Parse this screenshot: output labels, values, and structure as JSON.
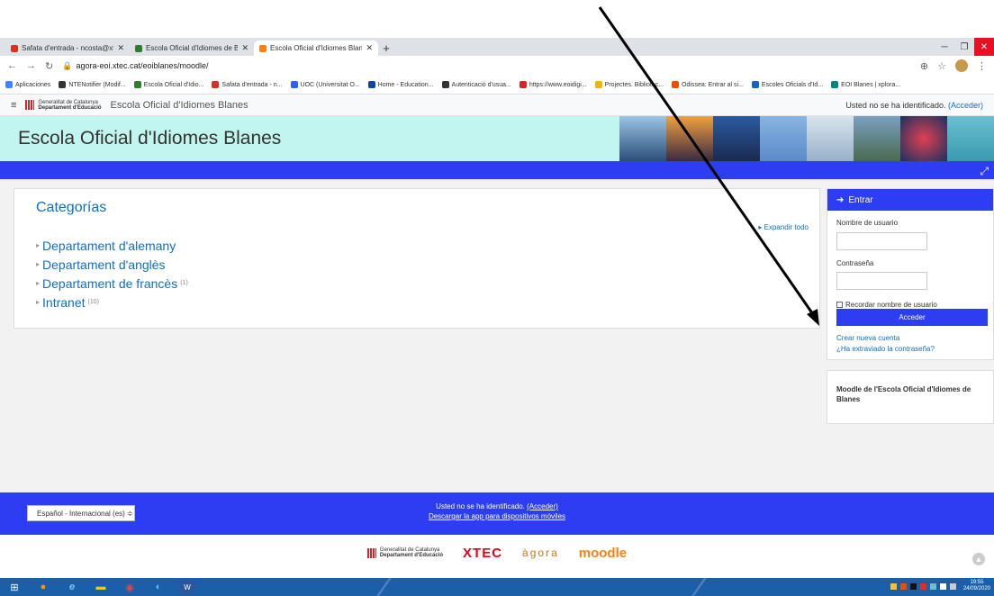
{
  "browser": {
    "tabs": [
      {
        "title": "Safata d'entrada - ncosta@xtec.c",
        "color": "#d93025"
      },
      {
        "title": "Escola Oficial d'Idiomes de Blan",
        "color": "#2e7d32"
      },
      {
        "title": "Escola Oficial d'Idiomes Blanes",
        "color": "#f98012"
      }
    ],
    "new_tab": "+",
    "url": "agora-eoi.xtec.cat/eoiblanes/moodle/",
    "bookmarks": [
      {
        "label": "Aplicaciones",
        "color": "#4285f4"
      },
      {
        "label": "NTENotifier (Modif...",
        "color": "#333333"
      },
      {
        "label": "Escola Oficial d'Idio...",
        "color": "#2e7d32"
      },
      {
        "label": "Safata d'entrada - n...",
        "color": "#d93025"
      },
      {
        "label": "UOC (Universitat O...",
        "color": "#2962ff"
      },
      {
        "label": "Home - Education...",
        "color": "#0d47a1"
      },
      {
        "label": "Autenticació d'usua...",
        "color": "#333333"
      },
      {
        "label": "https://www.eoidigi...",
        "color": "#d8232a"
      },
      {
        "label": "Projectes. Bibliotec...",
        "color": "#f4b400"
      },
      {
        "label": "Odissea: Entrar al si...",
        "color": "#e65100"
      },
      {
        "label": "Escoles Oficials d'Id...",
        "color": "#1565c0"
      },
      {
        "label": "EOI Blanes | xplora...",
        "color": "#00897b"
      }
    ]
  },
  "navbar": {
    "gencat_line1": "Generalitat de Catalunya",
    "gencat_line2": "Departament d'Educació",
    "site_name": "Escola Oficial d'Idiomes Blanes",
    "login_text": "Usted no se ha identificado.",
    "login_link": "(Acceder)"
  },
  "banner": {
    "title": "Escola Oficial d'Idiomes Blanes",
    "photo_colors": [
      "#2a4e7a",
      "#f0a040",
      "#2c5aa0",
      "#5a8ac8",
      "#d8e4ee",
      "#7aa0c0",
      "#1a3060",
      "#3a9ab0"
    ]
  },
  "categories": {
    "title": "Categorías",
    "expand_all": "Expandir todo",
    "items": [
      {
        "name": "Departament d'alemany",
        "count": ""
      },
      {
        "name": "Departament d'anglès",
        "count": ""
      },
      {
        "name": "Departament de francès",
        "count": "(1)"
      },
      {
        "name": "Intranet",
        "count": "(10)"
      }
    ]
  },
  "login_block": {
    "header": "Entrar",
    "username_label": "Nombre de usuario",
    "password_label": "Contraseña",
    "remember_label": "Recordar nombre de usuario",
    "submit_label": "Acceder",
    "create_account": "Crear nueva cuenta",
    "forgot_password": "¿Ha extraviado la contraseña?"
  },
  "info_block": {
    "text": "Moodle de l'Escola Oficial d'Idiomes de Blanes"
  },
  "footer": {
    "language": "Español - Internacional (es) ≑",
    "login_text": "Usted no se ha identificado.",
    "login_link": "(Acceder)",
    "app_link": "Descargar la app para dispositivos móviles"
  },
  "footer_logos": {
    "gencat_line1": "Generalitat de Catalunya",
    "gencat_line2": "Departament d'Educació",
    "xtec": "XTEC",
    "agora": "àgora",
    "moodle": "moodle"
  },
  "taskbar": {
    "time": "19:55",
    "date": "24/09/2020"
  }
}
